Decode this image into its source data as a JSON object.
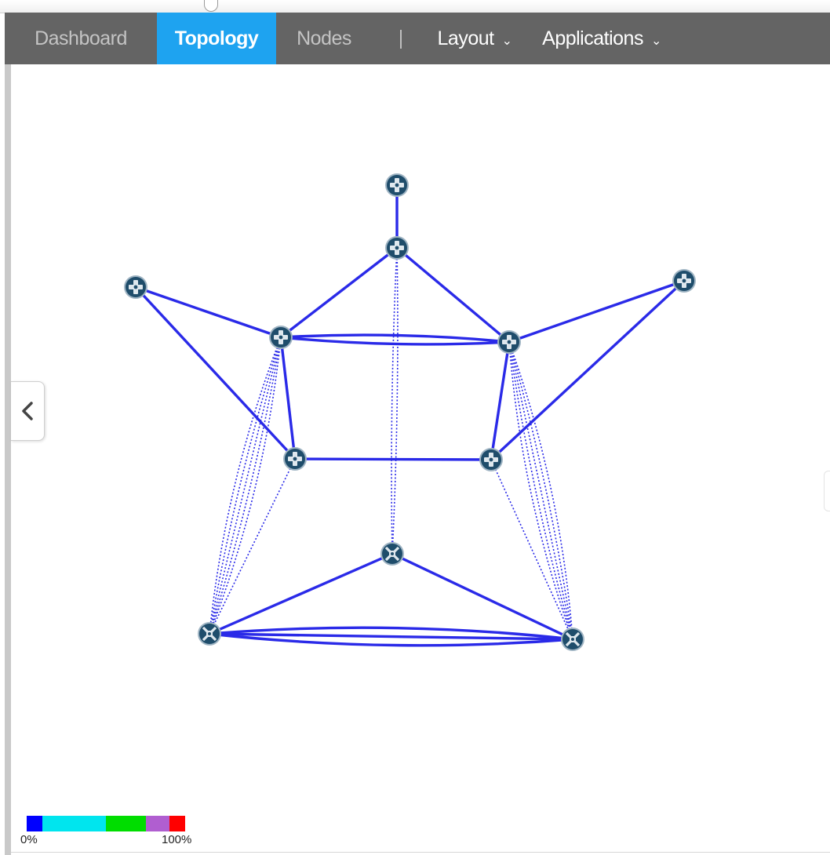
{
  "nav": {
    "items": [
      {
        "label": "Dashboard",
        "state": "inactive"
      },
      {
        "label": "Topology",
        "state": "active"
      },
      {
        "label": "Nodes",
        "state": "inactive"
      },
      {
        "label": "Layout",
        "state": "dropdown"
      },
      {
        "label": "Applications",
        "state": "dropdown"
      }
    ],
    "active_color": "#1ea3f0",
    "bar_color": "#646464"
  },
  "icons": {
    "collapse": "chevron-left-icon",
    "dropdown": "chevron-down-icon",
    "router": "router-node-icon",
    "switch": "switch-node-icon"
  },
  "topology": {
    "link_color": "#2a2ae8",
    "node_color": "#1f4d6b",
    "nodes": [
      {
        "id": "n1",
        "kind": "router"
      },
      {
        "id": "n2",
        "kind": "router"
      },
      {
        "id": "n3",
        "kind": "router"
      },
      {
        "id": "n4",
        "kind": "router"
      },
      {
        "id": "n5",
        "kind": "router"
      },
      {
        "id": "n6",
        "kind": "router"
      },
      {
        "id": "n7",
        "kind": "router"
      },
      {
        "id": "n8",
        "kind": "router"
      },
      {
        "id": "n9",
        "kind": "switch"
      },
      {
        "id": "n10",
        "kind": "switch"
      },
      {
        "id": "n11",
        "kind": "switch"
      }
    ],
    "links": [
      {
        "a": "n1",
        "b": "n2",
        "style": "solid",
        "count": 1
      },
      {
        "a": "n2",
        "b": "n4",
        "style": "solid",
        "count": 1
      },
      {
        "a": "n2",
        "b": "n5",
        "style": "solid",
        "count": 1
      },
      {
        "a": "n3",
        "b": "n4",
        "style": "solid",
        "count": 1
      },
      {
        "a": "n3",
        "b": "n6",
        "style": "solid",
        "count": 1
      },
      {
        "a": "n8",
        "b": "n5",
        "style": "solid",
        "count": 1
      },
      {
        "a": "n8",
        "b": "n7",
        "style": "solid",
        "count": 1
      },
      {
        "a": "n4",
        "b": "n5",
        "style": "solid",
        "count": 2
      },
      {
        "a": "n4",
        "b": "n6",
        "style": "solid",
        "count": 1
      },
      {
        "a": "n5",
        "b": "n7",
        "style": "solid",
        "count": 1
      },
      {
        "a": "n6",
        "b": "n7",
        "style": "solid",
        "count": 1
      },
      {
        "a": "n9",
        "b": "n10",
        "style": "solid",
        "count": 1
      },
      {
        "a": "n9",
        "b": "n11",
        "style": "solid",
        "count": 1
      },
      {
        "a": "n10",
        "b": "n11",
        "style": "solid",
        "count": 3
      },
      {
        "a": "n2",
        "b": "n9",
        "style": "dotted",
        "count": 2
      },
      {
        "a": "n4",
        "b": "n10",
        "style": "dotted",
        "count": 5
      },
      {
        "a": "n6",
        "b": "n10",
        "style": "dotted",
        "count": 1
      },
      {
        "a": "n5",
        "b": "n11",
        "style": "dotted",
        "count": 5
      },
      {
        "a": "n7",
        "b": "n11",
        "style": "dotted",
        "count": 1
      }
    ]
  },
  "legend": {
    "min_label": "0%",
    "max_label": "100%",
    "segments": [
      {
        "color": "#0000ff",
        "share": 0.1
      },
      {
        "color": "#00e5ee",
        "share": 0.4
      },
      {
        "color": "#00dd00",
        "share": 0.25
      },
      {
        "color": "#b05ed0",
        "share": 0.15
      },
      {
        "color": "#ff0000",
        "share": 0.1
      }
    ]
  }
}
